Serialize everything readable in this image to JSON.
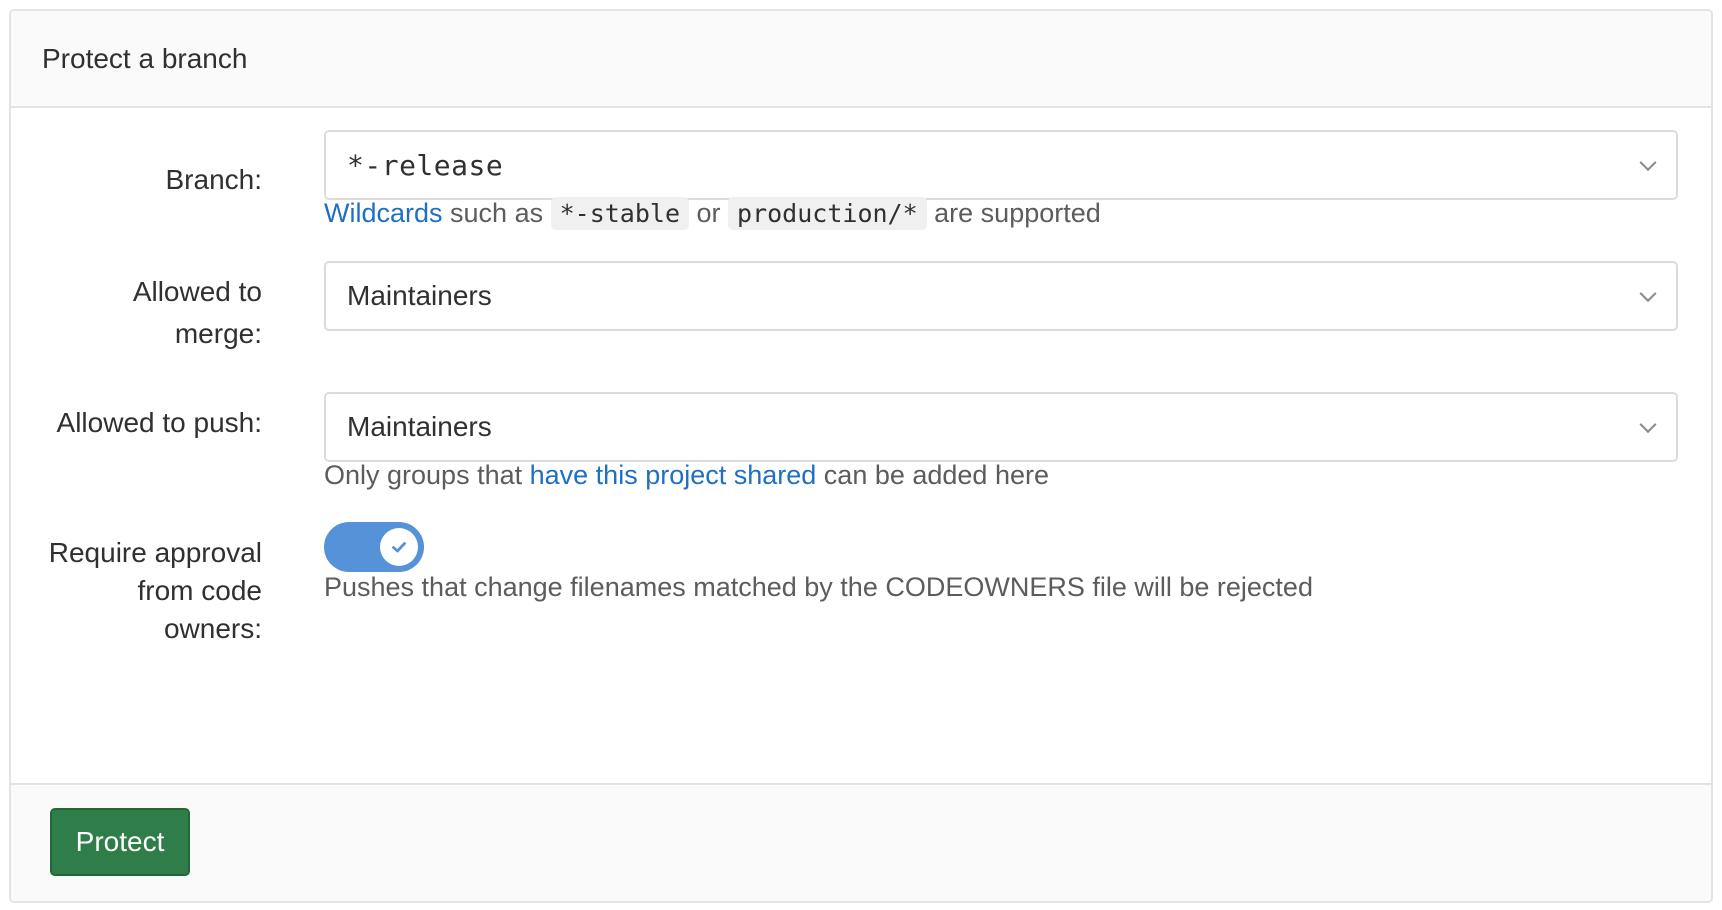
{
  "header": {
    "title": "Protect a branch"
  },
  "form": {
    "branch": {
      "label": "Branch:",
      "value": "*-release",
      "help": {
        "link": "Wildcards",
        "text1": " such as ",
        "code1": "*-stable",
        "text2": " or ",
        "code2": "production/*",
        "text3": " are supported"
      }
    },
    "merge": {
      "label_line1": "Allowed to",
      "label_line2": "merge:",
      "value": "Maintainers"
    },
    "push": {
      "label": "Allowed to push:",
      "value": "Maintainers",
      "help": {
        "text1": "Only groups that ",
        "link": "have this project shared",
        "text2": " can be added here"
      }
    },
    "codeowners": {
      "label_line1": "Require approval",
      "label_line2": "from code",
      "label_line3": "owners:",
      "enabled": true,
      "help": "Pushes that change filenames matched by the CODEOWNERS file will be rejected"
    }
  },
  "footer": {
    "protect_label": "Protect"
  },
  "colors": {
    "primary_button": "#2f7d48",
    "toggle_on": "#5592d8",
    "link": "#1f6fc5"
  },
  "icons": {
    "select_caret": "chevron-down-icon",
    "toggle_check": "check-icon"
  }
}
